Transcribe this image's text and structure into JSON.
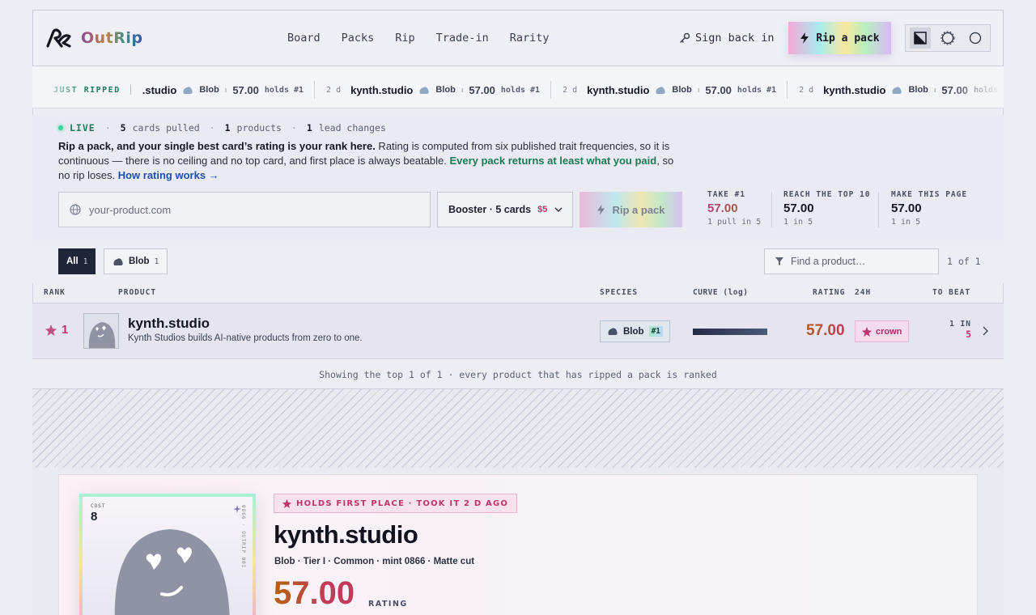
{
  "brand": {
    "name": "OutRip"
  },
  "nav": {
    "items": [
      "Board",
      "Packs",
      "Rip",
      "Trade-in",
      "Rarity"
    ]
  },
  "header": {
    "signin": "Sign back in",
    "rip_button": "Rip a pack"
  },
  "ticker": {
    "label": "JUST RIPPED",
    "items": [
      {
        "age": "",
        "name": ".studio",
        "species": "Blob",
        "score": "57.00",
        "holds": "holds #1"
      },
      {
        "age": "2 d",
        "name": "kynth.studio",
        "species": "Blob",
        "score": "57.00",
        "holds": "holds #1"
      },
      {
        "age": "2 d",
        "name": "kynth.studio",
        "species": "Blob",
        "score": "57.00",
        "holds": "holds #1"
      },
      {
        "age": "2 d",
        "name": "kynth.studio",
        "species": "Blob",
        "score": "57.00",
        "holds": "holds"
      }
    ]
  },
  "live": {
    "label": "LIVE",
    "cards_count": "5",
    "cards_label": "cards pulled",
    "products_count": "1",
    "products_label": "products",
    "lead_count": "1",
    "lead_label": "lead changes"
  },
  "intro": {
    "bold": "Rip a pack, and your single best card’s rating is your rank here.",
    "text1": " Rating is computed from six published trait frequencies, so it is continuous — there is no ceiling and no top card, and first place is always beatable. ",
    "green": "Every pack returns at least what you paid",
    "text2": ", so no rip loses. ",
    "link": "How rating works →"
  },
  "form": {
    "placeholder": "your-product.com",
    "pack": "Booster · 5 cards",
    "price": "$5",
    "rip_button": "Rip a pack"
  },
  "stats": [
    {
      "label": "TAKE #1",
      "value": "57.00",
      "sub": "1 pull in 5"
    },
    {
      "label": "REACH THE TOP 10",
      "value": "57.00",
      "sub": "1 in 5"
    },
    {
      "label": "MAKE THIS PAGE",
      "value": "57.00",
      "sub": "1 in 5"
    }
  ],
  "filters": {
    "all_label": "All",
    "all_count": "1",
    "blob_label": "Blob",
    "blob_count": "1",
    "find_placeholder": "Find a product…",
    "page_count": "1 of 1"
  },
  "table": {
    "headers": {
      "rank": "RANK",
      "product": "PRODUCT",
      "species": "SPECIES",
      "curve": "CURVE (log)",
      "rating": "RATING",
      "h24": "24H",
      "tobeat": "TO BEAT"
    },
    "rows": [
      {
        "rank": "1",
        "name": "kynth.studio",
        "desc": "Kynth Studios builds AI-native products from zero to one.",
        "species": "Blob",
        "species_rank": "#1",
        "rating": "57.00",
        "badge": "crown",
        "tobeat_label": "1 IN",
        "tobeat_value": "5"
      }
    ],
    "footer": "Showing the top 1 of 1 · every product that has ripped a pack is ranked"
  },
  "feature": {
    "badge": "HOLDS FIRST PLACE · TOOK IT 2 D AGO",
    "name": "kynth.studio",
    "meta": "Blob · Tier I · Common · mint 0866 · Matte cut",
    "rating": "57.00",
    "rating_label": "RATING",
    "card": {
      "cost_label": "COST",
      "cost": "8",
      "side": "0866 · OUTRIP 001"
    }
  },
  "colors": {
    "accent_pink": "#c0346c",
    "accent_green": "#1a7a56",
    "link_blue": "#1f4fa8",
    "dark": "#20253a"
  }
}
